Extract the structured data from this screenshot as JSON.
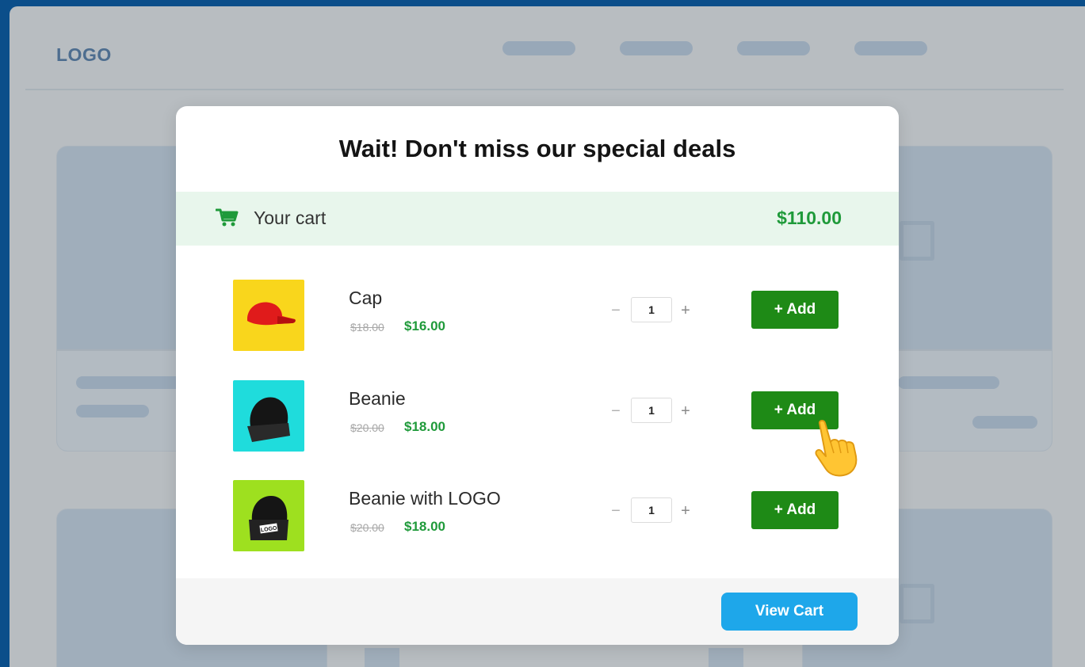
{
  "background": {
    "logo": "LOGO"
  },
  "modal": {
    "title": "Wait! Don't miss our special deals",
    "cart": {
      "icon": "cart-icon",
      "label": "Your cart",
      "total": "$110.00"
    },
    "items": [
      {
        "name": "Cap",
        "old_price": "$18.00",
        "new_price": "$16.00",
        "quantity": "1",
        "add_label": "+ Add",
        "thumb_color": "#f9d61c"
      },
      {
        "name": "Beanie",
        "old_price": "$20.00",
        "new_price": "$18.00",
        "quantity": "1",
        "add_label": "+ Add",
        "thumb_color": "#1fdcdc"
      },
      {
        "name": "Beanie with LOGO",
        "old_price": "$20.00",
        "new_price": "$18.00",
        "quantity": "1",
        "add_label": "+ Add",
        "thumb_color": "#9ee01f",
        "thumb_text": "LOGO"
      }
    ],
    "stepper": {
      "minus": "−",
      "plus": "+"
    },
    "view_cart_label": "View Cart"
  },
  "colors": {
    "accent_green": "#1e8a16",
    "price_green": "#1f9a3a",
    "view_cart_blue": "#1ea7ea",
    "outer_frame": "#0b4e8a"
  }
}
